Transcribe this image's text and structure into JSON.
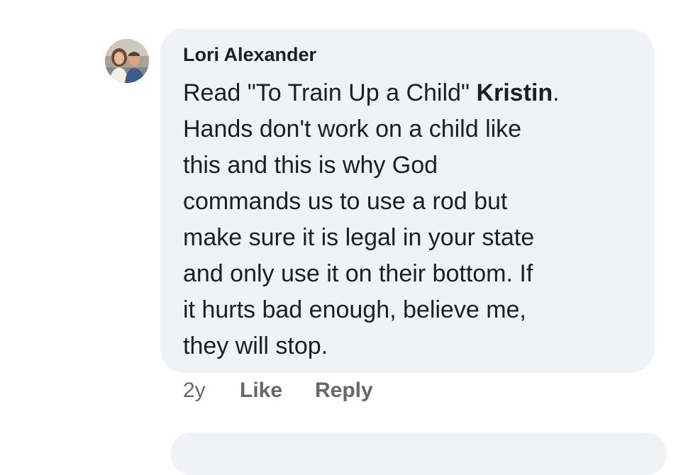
{
  "comment": {
    "author": "Lori Alexander",
    "text_lines": [
      [
        "Read \"To Train Up a Child\" ",
        "Kristin",
        "."
      ],
      "Hands don't work on a child like",
      "this and this is why God",
      "commands us to use a rod but",
      "make sure it is legal in your state",
      "and only use it on their bottom. If",
      "it hurts bad enough, believe me,",
      "they will stop."
    ],
    "time": "2y",
    "like_label": "Like",
    "reply_label": "Reply"
  },
  "colors": {
    "bubble_bg": "#f0f2f5",
    "text": "#1c1e21",
    "meta": "#65676b"
  },
  "icons": {
    "avatar": "profile-photo-two-people"
  }
}
